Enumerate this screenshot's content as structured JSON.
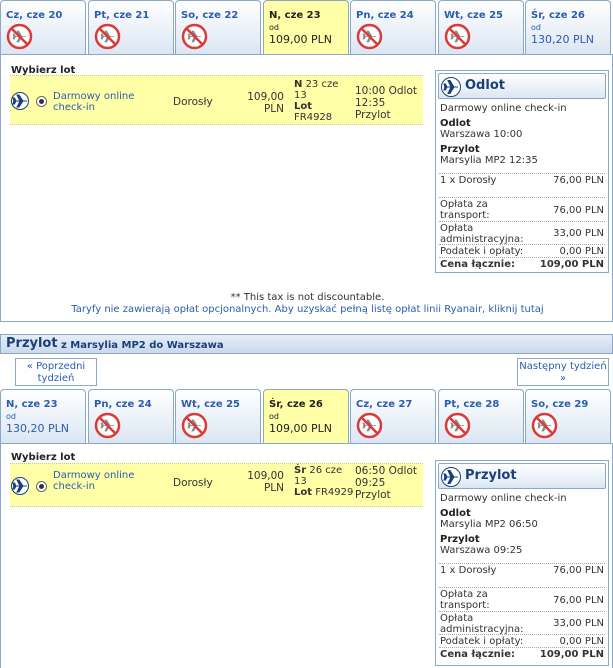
{
  "outbound": {
    "tabs": [
      {
        "label": "Cz, cze 20",
        "available": false
      },
      {
        "label": "Pt, cze 21",
        "available": false
      },
      {
        "label": "So, cze 22",
        "available": false
      },
      {
        "label": "N, cze 23",
        "available": true,
        "selected": true,
        "od": "od",
        "price": "109,00 PLN"
      },
      {
        "label": "Pn, cze 24",
        "available": false
      },
      {
        "label": "Wt, cze 25",
        "available": false
      },
      {
        "label": "Śr, cze 26",
        "available": true,
        "od": "od",
        "price": "130,20 PLN"
      }
    ],
    "choose_label": "Wybierz lot",
    "flight_row": {
      "fare_type": "Darmowy online check-in",
      "passenger": "Dorosły",
      "amount": "109,00 PLN",
      "day_bold": "N",
      "date": "23 cze 13",
      "flight_label": "Lot",
      "flight_no": "FR4928",
      "depart_time": "10:00",
      "depart_label": "Odlot",
      "arrive_time": "12:35",
      "arrive_label": "Przylot"
    },
    "summary": {
      "title": "Odlot",
      "fare_type": "Darmowy online check-in",
      "depart_heading": "Odlot",
      "depart_value": "Warszawa 10:00",
      "arrive_heading": "Przylot",
      "arrive_value": "Marsylia MP2 12:35",
      "pax_label": "1 x Dorosły",
      "pax_value": "76,00 PLN",
      "transport_label": "Opłata za transport:",
      "transport_value": "76,00 PLN",
      "admin_label": "Opłata administracyjna:",
      "admin_value": "33,00 PLN",
      "tax_label": "Podatek i opłaty:",
      "tax_value": "0,00 PLN",
      "total_label": "Cena łącznie:",
      "total_value": "109,00 PLN"
    },
    "tax_note": "** This tax is not discountable.",
    "fees_link": "Taryfy nie zawierają opłat opcjonalnych. Aby uzyskać pełną listę opłat linii Ryanair, kliknij tutaj"
  },
  "return_header": {
    "title": "Przylot",
    "route": "z Marsylia MP2 do Warszawa"
  },
  "nav": {
    "prev": "« Poprzedni tydzień",
    "next": "Następny tydzień »"
  },
  "inbound": {
    "tabs": [
      {
        "label": "N, cze 23",
        "available": true,
        "od": "od",
        "price": "130,20 PLN"
      },
      {
        "label": "Pn, cze 24",
        "available": false
      },
      {
        "label": "Wt, cze 25",
        "available": false
      },
      {
        "label": "Śr, cze 26",
        "available": true,
        "selected": true,
        "od": "od",
        "price": "109,00 PLN"
      },
      {
        "label": "Cz, cze 27",
        "available": false
      },
      {
        "label": "Pt, cze 28",
        "available": false
      },
      {
        "label": "So, cze 29",
        "available": false
      }
    ],
    "choose_label": "Wybierz lot",
    "flight_row": {
      "fare_type": "Darmowy online check-in",
      "passenger": "Dorosły",
      "amount": "109,00 PLN",
      "day_bold": "Śr",
      "date": "26 cze 13",
      "flight_label": "Lot",
      "flight_no": "FR4929",
      "depart_time": "06:50",
      "depart_label": "Odlot",
      "arrive_time": "09:25",
      "arrive_label": "Przylot"
    },
    "summary": {
      "title": "Przylot",
      "fare_type": "Darmowy online check-in",
      "depart_heading": "Odlot",
      "depart_value": "Marsylia MP2 06:50",
      "arrive_heading": "Przylot",
      "arrive_value": "Warszawa 09:25",
      "pax_label": "1 x Dorosły",
      "pax_value": "76,00 PLN",
      "transport_label": "Opłata za transport:",
      "transport_value": "76,00 PLN",
      "admin_label": "Opłata administracyjna:",
      "admin_value": "33,00 PLN",
      "tax_label": "Podatek i opłaty:",
      "tax_value": "0,00 PLN",
      "total_label": "Cena łącznie:",
      "total_value": "109,00 PLN"
    }
  }
}
